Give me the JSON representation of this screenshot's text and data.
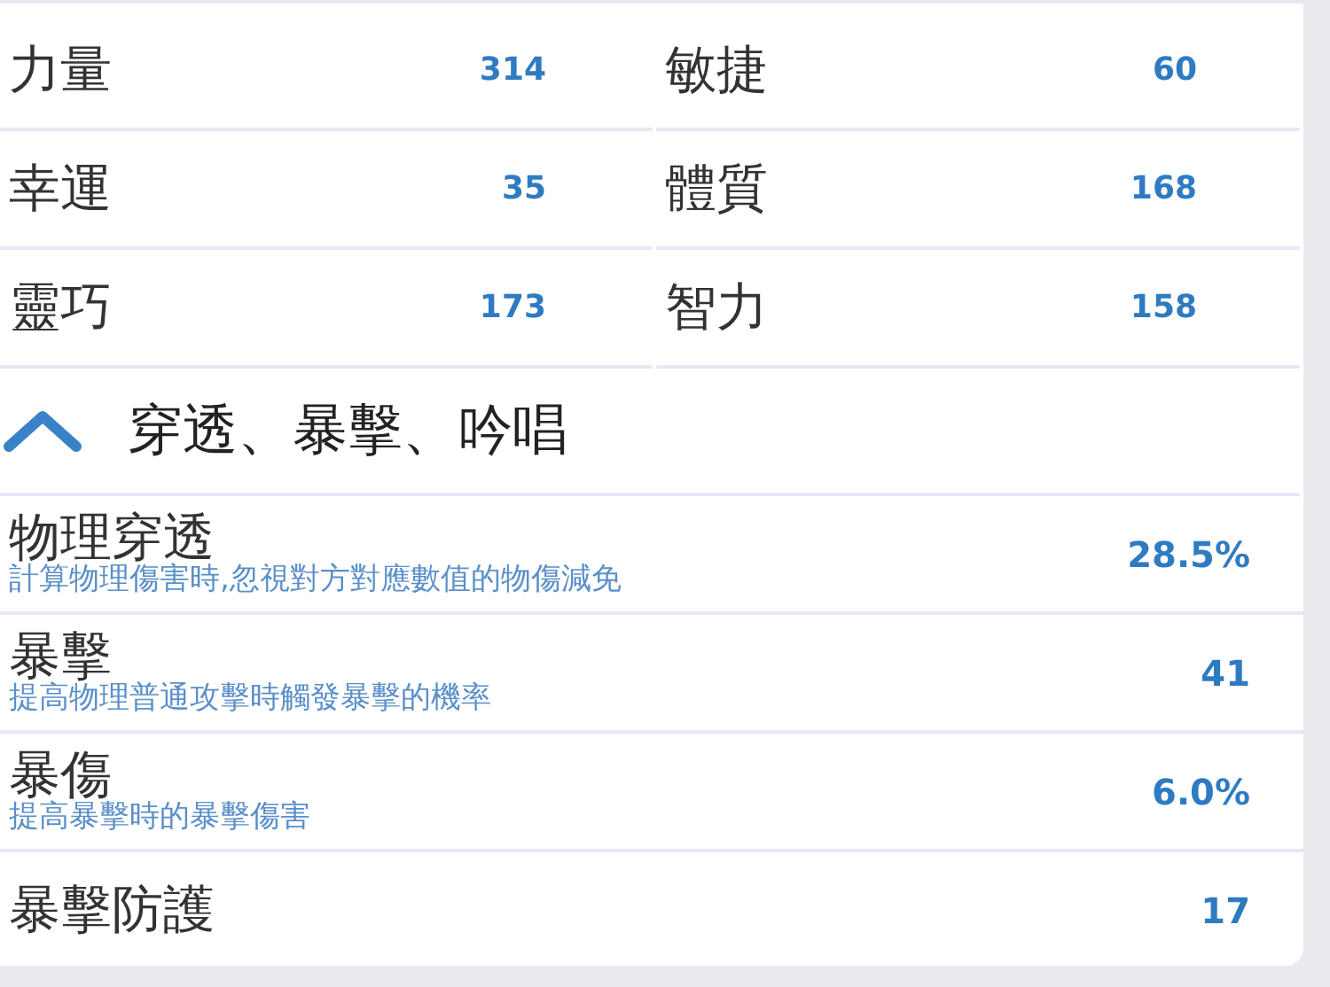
{
  "attributes": [
    {
      "label": "力量",
      "value": "314"
    },
    {
      "label": "敏捷",
      "value": "60"
    },
    {
      "label": "幸運",
      "value": "35"
    },
    {
      "label": "體質",
      "value": "168"
    },
    {
      "label": "靈巧",
      "value": "173"
    },
    {
      "label": "智力",
      "value": "158"
    }
  ],
  "section": {
    "title": "穿透、暴擊、吟唱",
    "expanded": true
  },
  "stats": [
    {
      "name": "物理穿透",
      "description": "計算物理傷害時,忽視對方對應數值的物傷減免",
      "value": "28.5%"
    },
    {
      "name": "暴擊",
      "description": "提高物理普通攻擊時觸發暴擊的機率",
      "value": "41"
    },
    {
      "name": "暴傷",
      "description": "提高暴擊時的暴擊傷害",
      "value": "6.0%"
    },
    {
      "name": "暴擊防護",
      "value": "17"
    }
  ]
}
